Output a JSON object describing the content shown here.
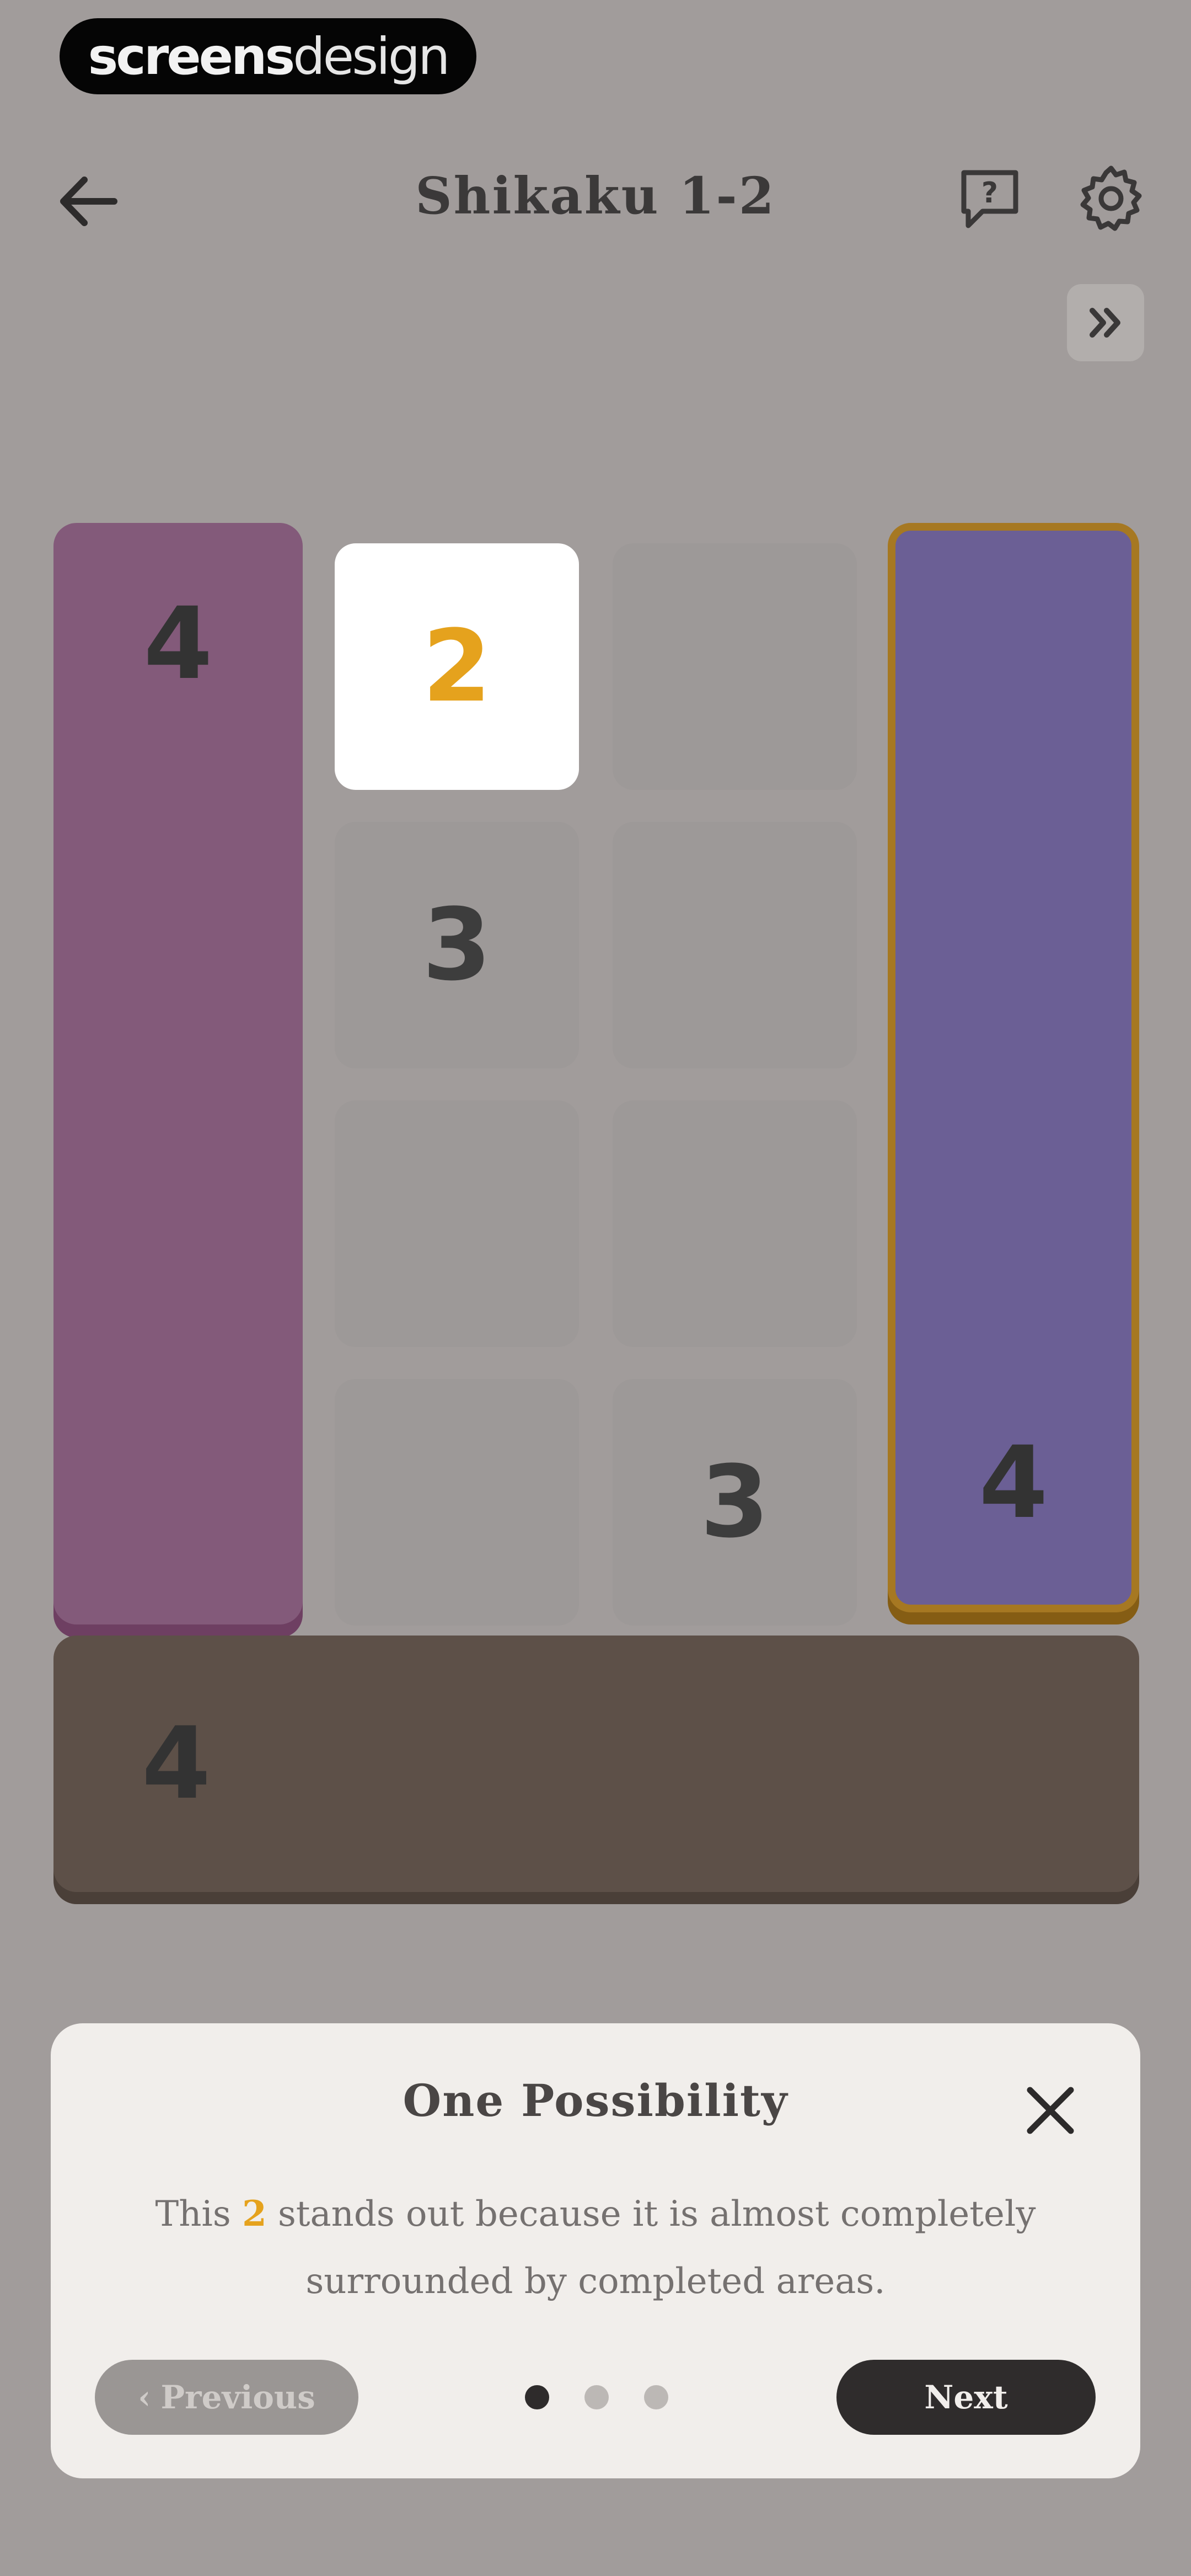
{
  "watermark": {
    "part1": "screens",
    "part2": "design"
  },
  "header": {
    "title": "Shikaku 1-2",
    "back_icon": "arrow-left-icon",
    "help_icon": "help-bubble-icon",
    "help_glyph": "?",
    "settings_icon": "gear-icon",
    "skip_icon": "double-chevron-right-icon"
  },
  "board": {
    "regions": {
      "pink": {
        "clue": "4",
        "color": "#835a7a"
      },
      "purple": {
        "clue": "4",
        "color": "#6b5f95",
        "border_color": "#a67822"
      },
      "brown": {
        "clue": "4",
        "color": "#5d5048"
      }
    },
    "cells": {
      "r1c2": "2",
      "r2c2": "3",
      "r4c3": "3"
    },
    "highlight_color": "#e5a21d"
  },
  "hint_sheet": {
    "title": "One Possibility",
    "message_before": "This ",
    "message_highlight": "2",
    "message_after": " stands out because it is almost completely surrounded by completed areas.",
    "close_icon": "close-icon",
    "previous_label": "Previous",
    "previous_icon": "chevron-left-icon",
    "next_label": "Next",
    "page_indicator": {
      "current": 1,
      "total": 3
    }
  }
}
